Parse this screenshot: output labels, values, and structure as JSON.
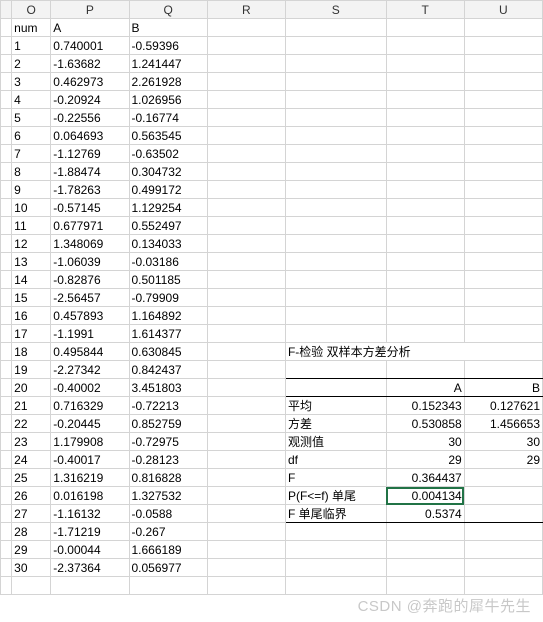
{
  "columns": {
    "O": "O",
    "P": "P",
    "Q": "Q",
    "R": "R",
    "S": "S",
    "T": "T",
    "U": "U"
  },
  "headers": {
    "num": "num",
    "A": "A",
    "B": "B"
  },
  "rows": [
    {
      "n": "1",
      "a": "0.740001",
      "b": "-0.59396"
    },
    {
      "n": "2",
      "a": "-1.63682",
      "b": "1.241447"
    },
    {
      "n": "3",
      "a": "0.462973",
      "b": "2.261928"
    },
    {
      "n": "4",
      "a": "-0.20924",
      "b": "1.026956"
    },
    {
      "n": "5",
      "a": "-0.22556",
      "b": "-0.16774"
    },
    {
      "n": "6",
      "a": "0.064693",
      "b": "0.563545"
    },
    {
      "n": "7",
      "a": "-1.12769",
      "b": "-0.63502"
    },
    {
      "n": "8",
      "a": "-1.88474",
      "b": "0.304732"
    },
    {
      "n": "9",
      "a": "-1.78263",
      "b": "0.499172"
    },
    {
      "n": "10",
      "a": "-0.57145",
      "b": "1.129254"
    },
    {
      "n": "11",
      "a": "0.677971",
      "b": "0.552497"
    },
    {
      "n": "12",
      "a": "1.348069",
      "b": "0.134033"
    },
    {
      "n": "13",
      "a": "-1.06039",
      "b": "-0.03186"
    },
    {
      "n": "14",
      "a": "-0.82876",
      "b": "0.501185"
    },
    {
      "n": "15",
      "a": "-2.56457",
      "b": "-0.79909"
    },
    {
      "n": "16",
      "a": "0.457893",
      "b": "1.164892"
    },
    {
      "n": "17",
      "a": "-1.1991",
      "b": "1.614377"
    },
    {
      "n": "18",
      "a": "0.495844",
      "b": "0.630845"
    },
    {
      "n": "19",
      "a": "-2.27342",
      "b": "0.842437"
    },
    {
      "n": "20",
      "a": "-0.40002",
      "b": "3.451803"
    },
    {
      "n": "21",
      "a": "0.716329",
      "b": "-0.72213"
    },
    {
      "n": "22",
      "a": "-0.20445",
      "b": "0.852759"
    },
    {
      "n": "23",
      "a": "1.179908",
      "b": "-0.72975"
    },
    {
      "n": "24",
      "a": "-0.40017",
      "b": "-0.28123"
    },
    {
      "n": "25",
      "a": "1.316219",
      "b": "0.816828"
    },
    {
      "n": "26",
      "a": "0.016198",
      "b": "1.327532"
    },
    {
      "n": "27",
      "a": "-1.16132",
      "b": "-0.0588"
    },
    {
      "n": "28",
      "a": "-1.71219",
      "b": "-0.267"
    },
    {
      "n": "29",
      "a": "-0.00044",
      "b": "1.666189"
    },
    {
      "n": "30",
      "a": "-2.37364",
      "b": "0.056977"
    }
  ],
  "stats": {
    "title": "F-检验 双样本方差分析",
    "col_a": "A",
    "col_b": "B",
    "labels": {
      "mean": "平均",
      "variance": "方差",
      "obs": "观测值",
      "df": "df",
      "F": "F",
      "p": "P(F<=f) 单尾",
      "fcrit": "F 单尾临界"
    },
    "values": {
      "mean_a": "0.152343",
      "mean_b": "0.127621",
      "var_a": "0.530858",
      "var_b": "1.456653",
      "obs_a": "30",
      "obs_b": "30",
      "df_a": "29",
      "df_b": "29",
      "F": "0.364437",
      "p": "0.004134",
      "fcrit": "0.5374"
    }
  },
  "watermark": "CSDN @奔跑的犀牛先生"
}
